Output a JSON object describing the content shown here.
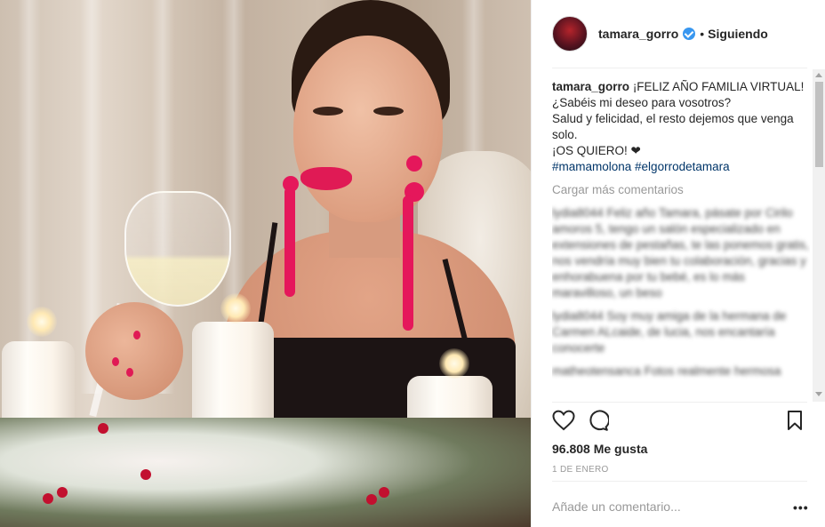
{
  "post": {
    "author": {
      "username": "tamara_gorro",
      "verified": true,
      "follow_status": "Siguiendo",
      "separator": "•"
    },
    "caption": {
      "username": "tamara_gorro",
      "lines": [
        "¡FELIZ AÑO FAMILIA VIRTUAL!",
        "¿Sabéis mi deseo para vosotros?",
        "Salud y felicidad, el resto dejemos que venga solo.",
        "¡OS QUIERO! ❤"
      ],
      "hashtags": "#mamamolona #elgorrodetamara"
    },
    "load_more_label": "Cargar más comentarios",
    "comments_blurred": [
      "lydia8044 Feliz año Tamara, pásate por Cirilo amoros 5, tengo un salón especializado en extensiones de pestañas, te las ponemos gratis, nos vendría muy bien tu colaboración, gracias y enhorabuena por tu bebé, es lo más maravilloso, un beso",
      "lydia8044 Soy muy amiga de la hermana de Carmen ALcaide, de lucia, nos encantaría conocerte",
      "matheotensanca Fotos realmente hermosa"
    ],
    "likes": "96.808 Me gusta",
    "date": "1 DE ENERO",
    "add_comment_placeholder": "Añade un comentario...",
    "more_options": "•••"
  },
  "icons": [
    "heart-icon",
    "comment-icon",
    "bookmark-icon",
    "verified-badge-icon"
  ],
  "colors": {
    "verified_blue": "#3897f0",
    "hashtag_link": "#003569",
    "muted_text": "#999999",
    "text": "#262626"
  }
}
